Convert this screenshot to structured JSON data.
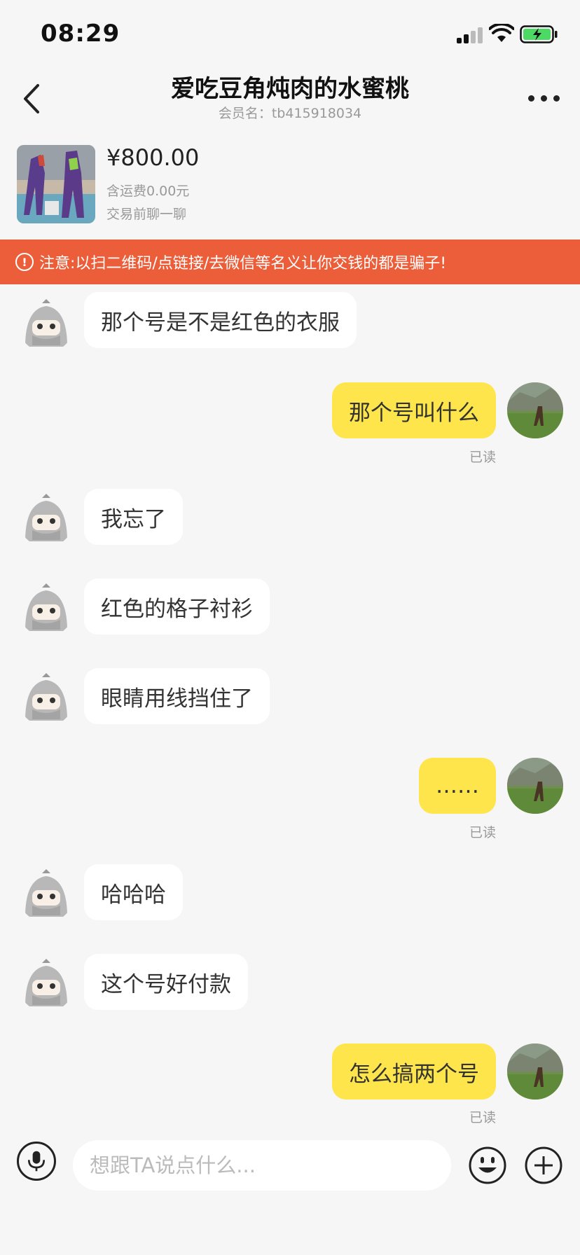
{
  "status": {
    "time": "08:29"
  },
  "nav": {
    "title": "爱吃豆角炖肉的水蜜桃",
    "subtitle": "会员名：tb415918034"
  },
  "product": {
    "price": "¥800.00",
    "shipping": "含运费0.00元",
    "note": "交易前聊一聊"
  },
  "warning": {
    "text": "注意:以扫二维码/点链接/去微信等名义让你交钱的都是骗子!"
  },
  "messages": [
    {
      "side": "left",
      "text": "那个号是不是红色的衣服"
    },
    {
      "side": "right",
      "text": "那个号叫什么",
      "status": "已读"
    },
    {
      "side": "left",
      "text": "我忘了"
    },
    {
      "side": "left",
      "text": "红色的格子衬衫"
    },
    {
      "side": "left",
      "text": "眼睛用线挡住了"
    },
    {
      "side": "right",
      "text": "……",
      "status": "已读"
    },
    {
      "side": "left",
      "text": "哈哈哈"
    },
    {
      "side": "left",
      "text": "这个号好付款"
    },
    {
      "side": "right",
      "text": "怎么搞两个号",
      "status": "已读"
    }
  ],
  "input": {
    "placeholder": "想跟TA说点什么..."
  },
  "colors": {
    "accent_yellow": "#fde54b",
    "warning_red": "#ec5e39",
    "background": "#f6f6f6"
  }
}
